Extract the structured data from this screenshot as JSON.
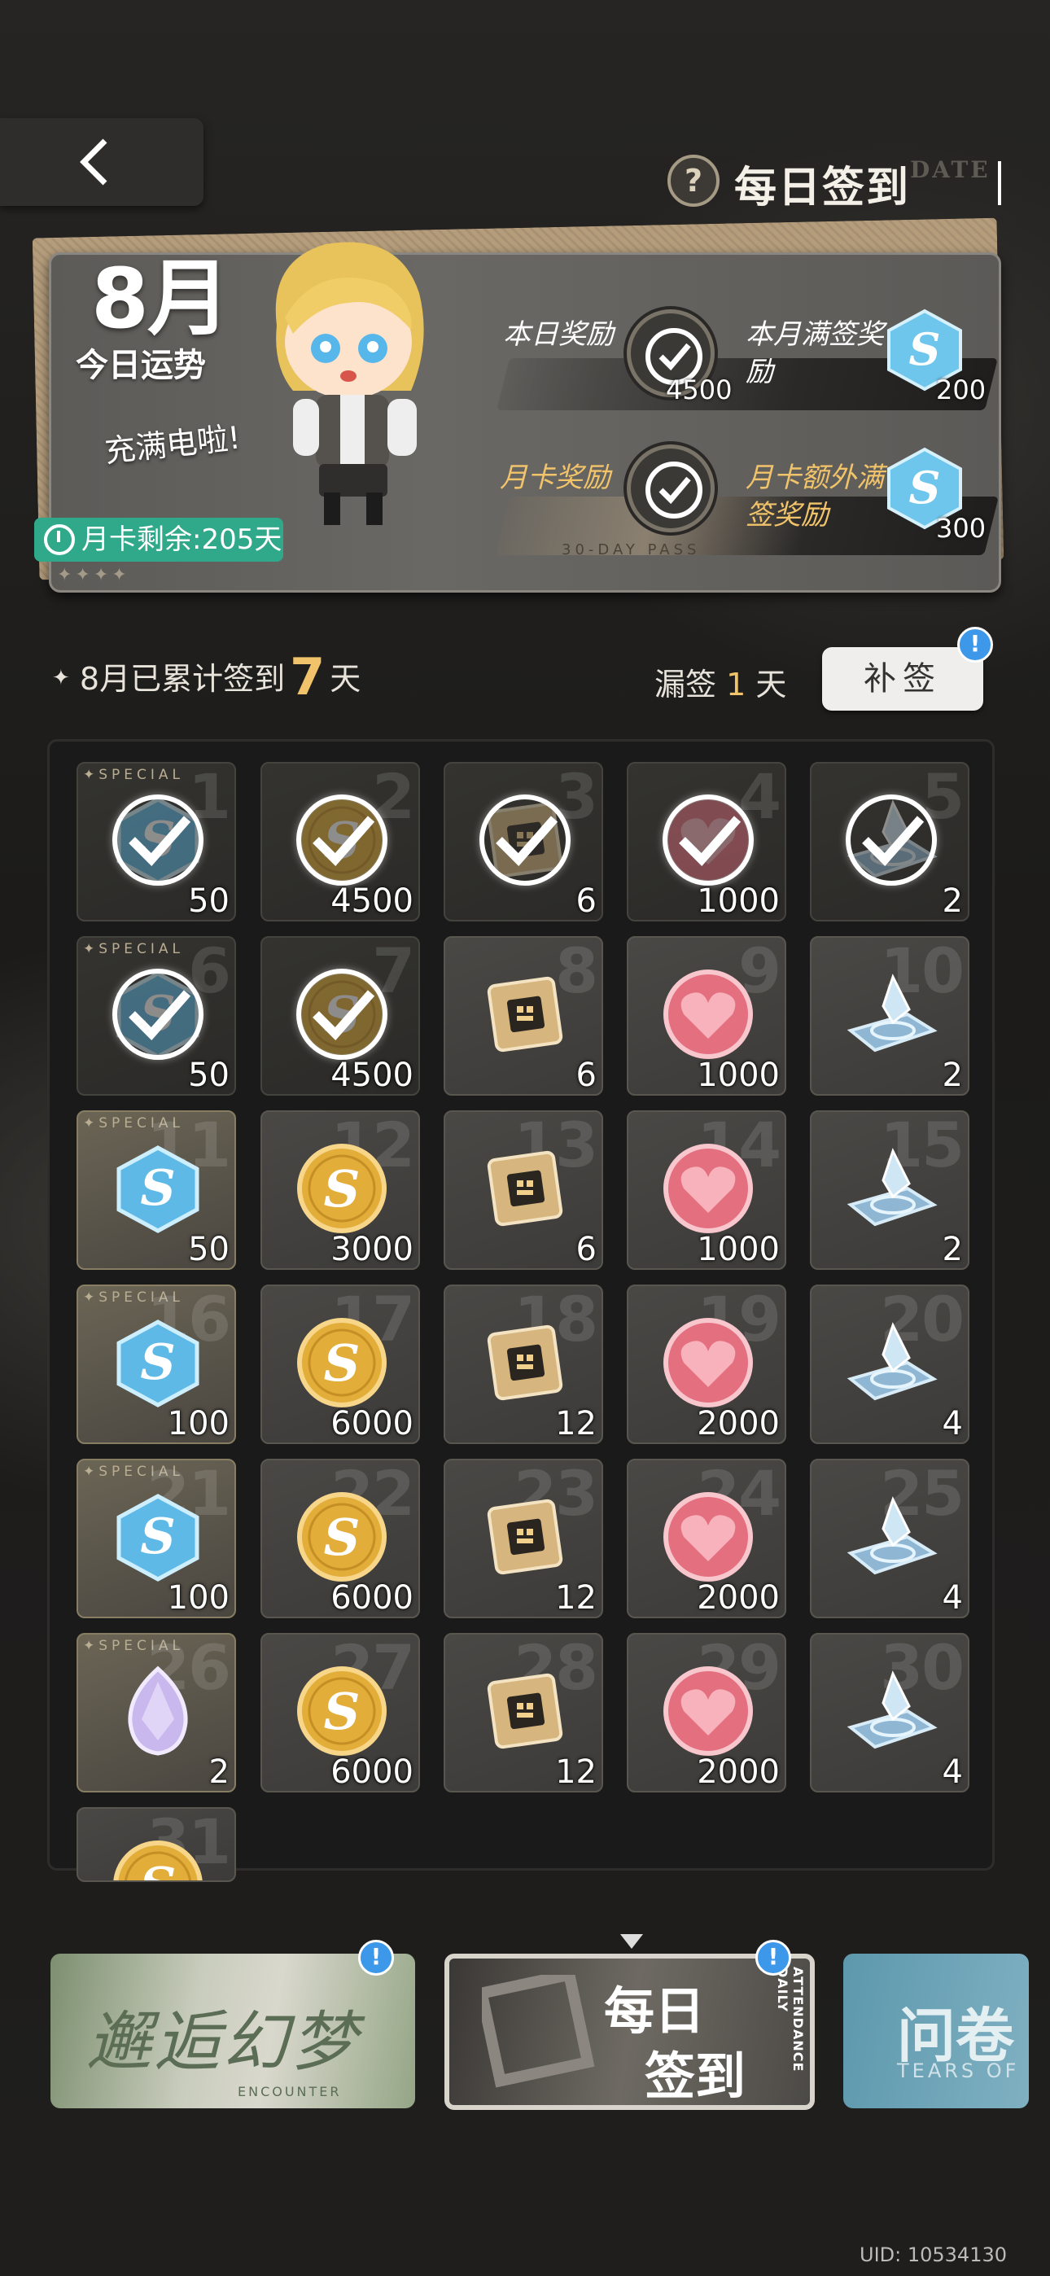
{
  "header": {
    "title": "每日签到",
    "date_tag": "DATE",
    "help_icon": "question-mark-icon"
  },
  "summary": {
    "month": "8月",
    "fortune_label": "今日运势",
    "mood_text": "充满电啦!",
    "pass_remaining": "月卡剩余:205天",
    "today_reward_label": "本日奖励",
    "today_reward_amount": "4500",
    "month_full_label": "本月满签奖励",
    "month_full_amount": "200",
    "pass_reward_label": "月卡奖励",
    "pass_tag": "30-DAY PASS",
    "pass_extra_label": "月卡额外满签奖励",
    "pass_extra_amount": "300"
  },
  "progress": {
    "accum_prefix": "8月已累计签到",
    "accum_days": "7",
    "accum_suffix": "天",
    "missed_prefix": "漏签",
    "missed_days": "1",
    "missed_suffix": "天",
    "makeup_button": "补签"
  },
  "calendar": {
    "special_label": "SPECIAL",
    "days": [
      {
        "day": "1",
        "type": "hex",
        "amount": "50",
        "special": true,
        "done": true
      },
      {
        "day": "2",
        "type": "coin",
        "amount": "4500",
        "special": false,
        "done": true
      },
      {
        "day": "3",
        "type": "chip",
        "amount": "6",
        "special": false,
        "done": true
      },
      {
        "day": "4",
        "type": "heart",
        "amount": "1000",
        "special": false,
        "done": true
      },
      {
        "day": "5",
        "type": "stand",
        "amount": "2",
        "special": false,
        "done": true
      },
      {
        "day": "6",
        "type": "hex",
        "amount": "50",
        "special": true,
        "done": true
      },
      {
        "day": "7",
        "type": "coin",
        "amount": "4500",
        "special": false,
        "done": true
      },
      {
        "day": "8",
        "type": "chip",
        "amount": "6",
        "special": false,
        "done": false
      },
      {
        "day": "9",
        "type": "heart",
        "amount": "1000",
        "special": false,
        "done": false
      },
      {
        "day": "10",
        "type": "stand",
        "amount": "2",
        "special": false,
        "done": false
      },
      {
        "day": "11",
        "type": "hex",
        "amount": "50",
        "special": true,
        "done": false
      },
      {
        "day": "12",
        "type": "coin",
        "amount": "3000",
        "special": false,
        "done": false
      },
      {
        "day": "13",
        "type": "chip",
        "amount": "6",
        "special": false,
        "done": false
      },
      {
        "day": "14",
        "type": "heart",
        "amount": "1000",
        "special": false,
        "done": false
      },
      {
        "day": "15",
        "type": "stand",
        "amount": "2",
        "special": false,
        "done": false
      },
      {
        "day": "16",
        "type": "hex",
        "amount": "100",
        "special": true,
        "done": false
      },
      {
        "day": "17",
        "type": "coin",
        "amount": "6000",
        "special": false,
        "done": false
      },
      {
        "day": "18",
        "type": "chip",
        "amount": "12",
        "special": false,
        "done": false
      },
      {
        "day": "19",
        "type": "heart",
        "amount": "2000",
        "special": false,
        "done": false
      },
      {
        "day": "20",
        "type": "stand",
        "amount": "4",
        "special": false,
        "done": false
      },
      {
        "day": "21",
        "type": "hex",
        "amount": "100",
        "special": true,
        "done": false
      },
      {
        "day": "22",
        "type": "coin",
        "amount": "6000",
        "special": false,
        "done": false
      },
      {
        "day": "23",
        "type": "chip",
        "amount": "12",
        "special": false,
        "done": false
      },
      {
        "day": "24",
        "type": "heart",
        "amount": "2000",
        "special": false,
        "done": false
      },
      {
        "day": "25",
        "type": "stand",
        "amount": "4",
        "special": false,
        "done": false
      },
      {
        "day": "26",
        "type": "gem",
        "amount": "2",
        "special": true,
        "done": false
      },
      {
        "day": "27",
        "type": "coin",
        "amount": "6000",
        "special": false,
        "done": false
      },
      {
        "day": "28",
        "type": "chip",
        "amount": "12",
        "special": false,
        "done": false
      },
      {
        "day": "29",
        "type": "heart",
        "amount": "2000",
        "special": false,
        "done": false
      },
      {
        "day": "30",
        "type": "stand",
        "amount": "4",
        "special": false,
        "done": false
      },
      {
        "day": "31",
        "type": "coin",
        "amount": "",
        "special": false,
        "done": false
      }
    ]
  },
  "nav": {
    "item1": {
      "title": "邂逅幻梦",
      "sub": "ENCOUNTER"
    },
    "item2": {
      "line1": "每日",
      "line2": "签到",
      "side": "ATTENDANCE DAILY"
    },
    "item3": {
      "title": "问卷",
      "sub": "TEARS OF"
    }
  },
  "footer": {
    "uid": "UID: 10534130"
  }
}
